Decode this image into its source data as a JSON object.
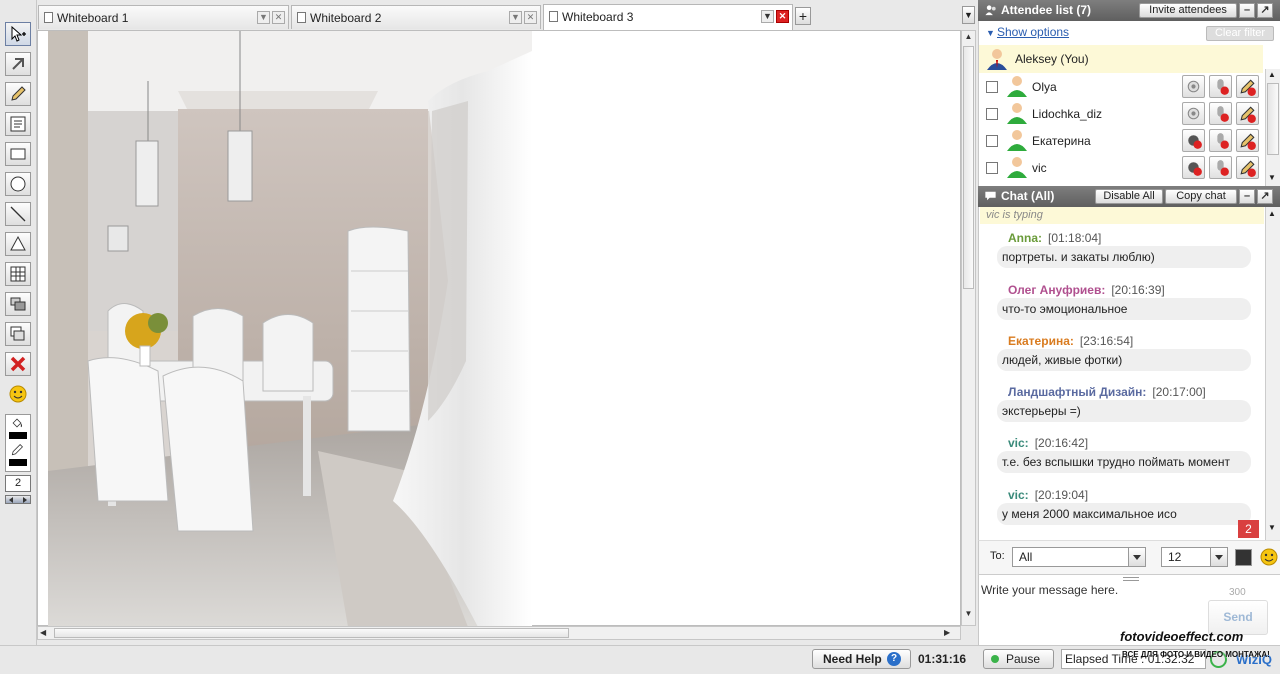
{
  "tabs": [
    {
      "label": "Whiteboard 1"
    },
    {
      "label": "Whiteboard 2"
    },
    {
      "label": "Whiteboard 3"
    }
  ],
  "tab_add": "+",
  "toolbar": {
    "line_width": "2",
    "icons": [
      "move-icon",
      "pointer-icon",
      "pencil-icon",
      "text-icon",
      "rectangle-icon",
      "circle-icon",
      "line-icon",
      "triangle-icon",
      "table-icon",
      "layers-icon",
      "copy-icon",
      "delete-icon",
      "smiley-icon",
      "fill-icon",
      "stroke-icon"
    ]
  },
  "attendees": {
    "title": "Attendee list (7)",
    "invite_label": "Invite attendees",
    "show_options": "Show options",
    "clear_filter": "Clear filter",
    "me": "Aleksey (You)",
    "list": [
      {
        "name": "Olya"
      },
      {
        "name": "Lidochka_diz"
      },
      {
        "name": "Екатерина"
      },
      {
        "name": "vic"
      }
    ]
  },
  "chat": {
    "title": "Chat (All)",
    "disable_all": "Disable All",
    "copy_chat": "Copy chat",
    "typing": "vic is typing",
    "messages": [
      {
        "author": "Anna:",
        "time": "[01:18:04]",
        "text": "портреты. и закаты люблю)",
        "color": "#6a9b3a"
      },
      {
        "author": "Олег Ануфриев:",
        "time": "[20:16:39]",
        "text": "что-то эмоциональное",
        "color": "#b0508f"
      },
      {
        "author": "Екатерина:",
        "time": "[23:16:54]",
        "text": "людей, живые фотки)",
        "color": "#d97b1f"
      },
      {
        "author": "Ландшафтный Дизайн:",
        "time": "[20:17:00]",
        "text": "экстерьеры =)",
        "color": "#5a6aa0"
      },
      {
        "author": "vic:",
        "time": "[20:16:42]",
        "text": "т.е. без вспышки трудно поймать момент",
        "color": "#3a8a7a"
      },
      {
        "author": "vic:",
        "time": "[20:19:04]",
        "text": "у меня 2000 максимальное исо",
        "color": "#3a8a7a"
      }
    ],
    "unread": "2",
    "to_label": "To:",
    "to_value": "All",
    "font_size": "12",
    "input_placeholder": "Write your message here.",
    "char_limit": "300",
    "send_label": "Send"
  },
  "status": {
    "need_help": "Need Help",
    "timer": "01:31:16",
    "pause": "Pause",
    "elapsed": "Elapsed Time : 01:32:32",
    "watermark": "fotovideoeffect.com",
    "watermark_sub": "ВСЕ ДЛЯ ФОТО И ВИДЕО МОНТАЖА!",
    "brand": "WizIQ"
  },
  "colors": {
    "header_gray": "#666666",
    "accent_blue": "#2a5db0",
    "me_row": "#fdf9d7",
    "delete_red": "#d22222"
  }
}
